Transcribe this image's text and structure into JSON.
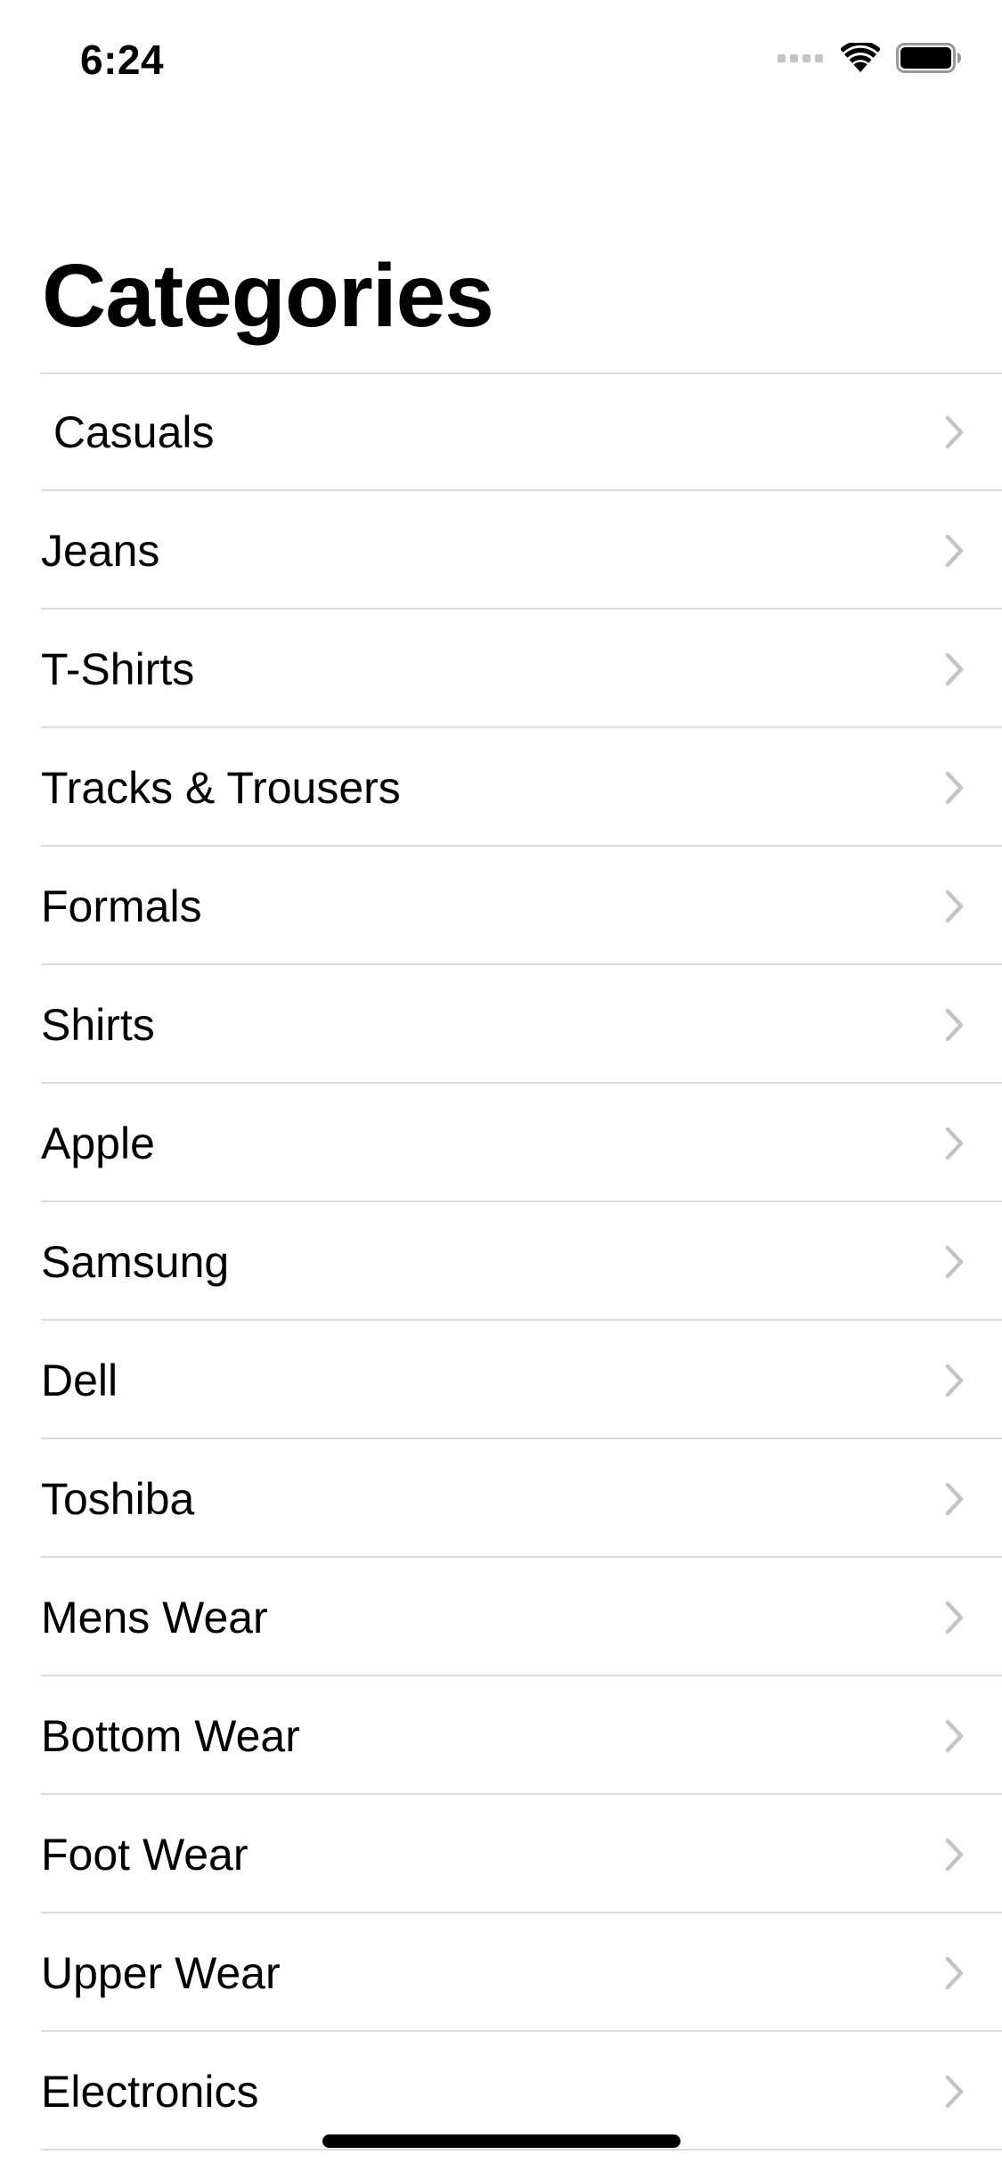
{
  "status_bar": {
    "time": "6:24"
  },
  "navigation": {
    "title": "Categories"
  },
  "categories": [
    {
      "label": " Casuals"
    },
    {
      "label": "Jeans"
    },
    {
      "label": "T-Shirts"
    },
    {
      "label": "Tracks & Trousers"
    },
    {
      "label": "Formals"
    },
    {
      "label": "Shirts"
    },
    {
      "label": "Apple"
    },
    {
      "label": "Samsung"
    },
    {
      "label": "Dell"
    },
    {
      "label": "Toshiba"
    },
    {
      "label": "Mens Wear"
    },
    {
      "label": "Bottom Wear"
    },
    {
      "label": "Foot Wear"
    },
    {
      "label": "Upper Wear"
    },
    {
      "label": "Electronics"
    }
  ],
  "icons": {
    "row_accessory": "chevron-right-icon",
    "signal": "cellular-signal-icon",
    "wifi": "wifi-icon",
    "battery": "battery-icon"
  },
  "colors": {
    "background": "#ffffff",
    "text": "#000000",
    "separator": "#dcdcdc",
    "chevron": "#c4c4c7"
  }
}
